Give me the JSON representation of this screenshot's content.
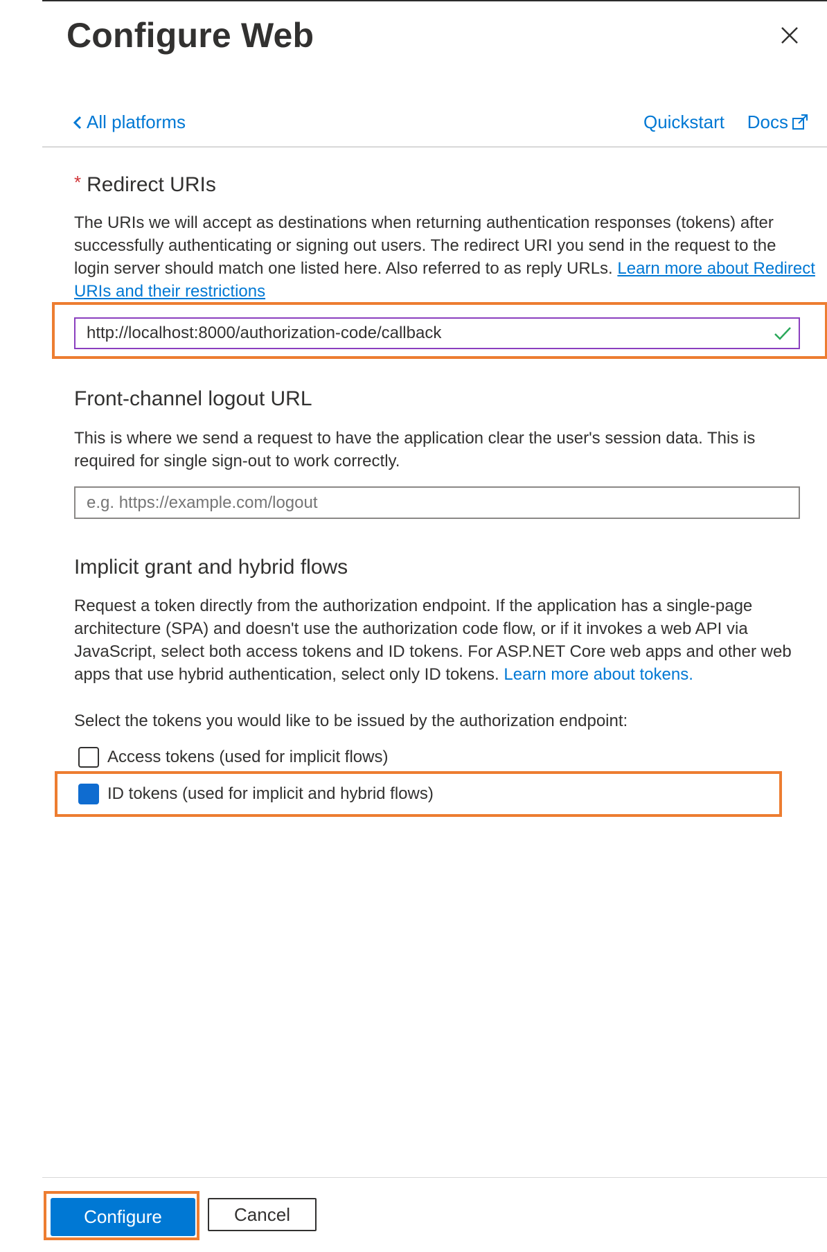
{
  "header": {
    "title": "Configure Web"
  },
  "nav": {
    "back_label": "All platforms",
    "quickstart_label": "Quickstart",
    "docs_label": "Docs"
  },
  "redirect": {
    "required_marker": "*",
    "title": "Redirect URIs",
    "description": "The URIs we will accept as destinations when returning authentication responses (tokens) after successfully authenticating or signing out users. The redirect URI you send in the request to the login server should match one listed here. Also referred to as reply URLs.",
    "learn_more_link": "Learn more about Redirect URIs and their restrictions",
    "uri_value": "http://localhost:8000/authorization-code/callback"
  },
  "logout": {
    "title": "Front-channel logout URL",
    "description": "This is where we send a request to have the application clear the user's session data. This is required for single sign-out to work correctly.",
    "placeholder": "e.g. https://example.com/logout"
  },
  "implicit": {
    "title": "Implicit grant and hybrid flows",
    "description": "Request a token directly from the authorization endpoint. If the application has a single-page architecture (SPA) and doesn't use the authorization code flow, or if it invokes a web API via JavaScript, select both access tokens and ID tokens. For ASP.NET Core web apps and other web apps that use hybrid authentication, select only ID tokens.",
    "learn_more_link": "Learn more about tokens.",
    "select_prompt": "Select the tokens you would like to be issued by the authorization endpoint:",
    "access_tokens_label": "Access tokens (used for implicit flows)",
    "access_tokens_checked": false,
    "id_tokens_label": "ID tokens (used for implicit and hybrid flows)",
    "id_tokens_checked": true
  },
  "footer": {
    "configure_label": "Configure",
    "cancel_label": "Cancel"
  },
  "colors": {
    "accent": "#0078d4",
    "highlight": "#ed7d31",
    "valid_check": "#2aa85a"
  }
}
